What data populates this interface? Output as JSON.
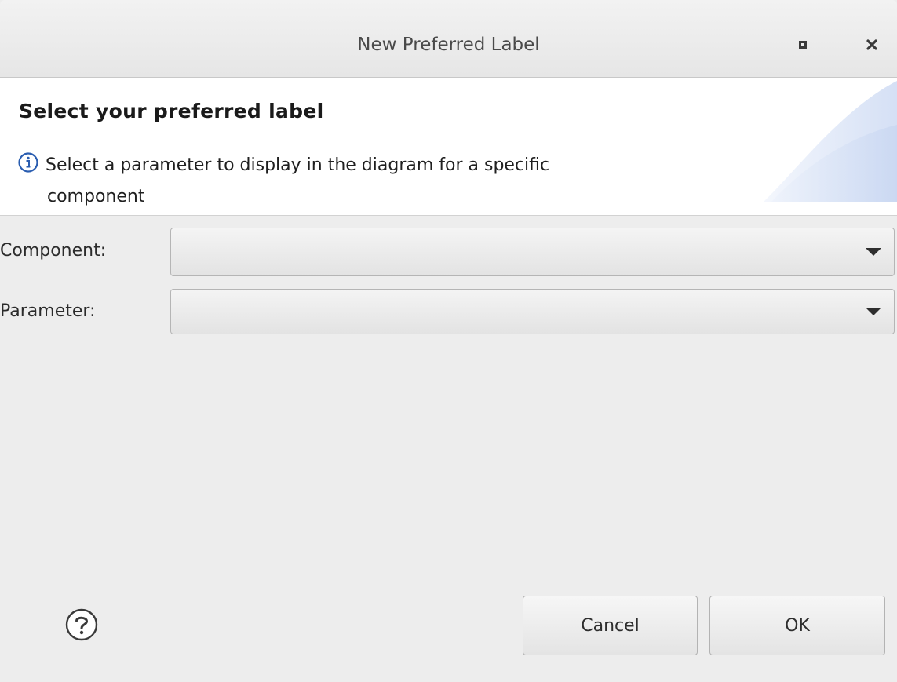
{
  "window": {
    "title": "New Preferred Label"
  },
  "banner": {
    "title": "Select your preferred label",
    "message_line1": "Select a parameter to display in the diagram for a specific",
    "message_line2": "component"
  },
  "form": {
    "component_label": "Component:",
    "component_value": "",
    "parameter_label": "Parameter:",
    "parameter_value": ""
  },
  "buttons": {
    "cancel": "Cancel",
    "ok": "OK"
  },
  "icons": {
    "maximize": "maximize-icon",
    "close": "close-icon",
    "info": "info-icon",
    "help": "help-icon"
  },
  "colors": {
    "info_accent": "#2a5db0",
    "dialog_background": "#ededed",
    "banner_background": "#ffffff"
  }
}
